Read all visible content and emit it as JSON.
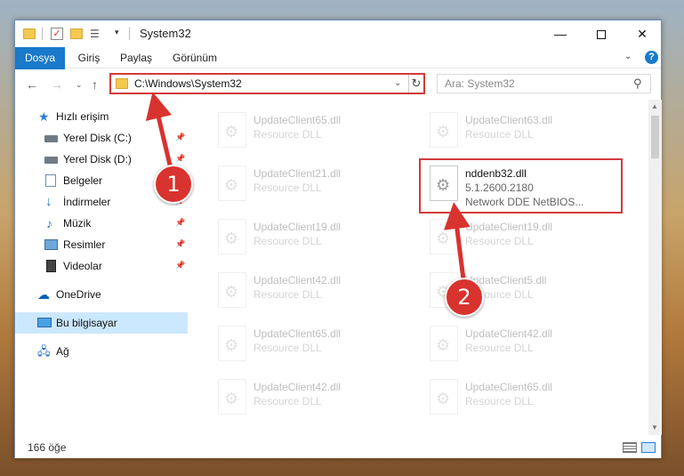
{
  "window": {
    "title": "System32"
  },
  "ribbon": {
    "tabs": [
      "Dosya",
      "Giriş",
      "Paylaş",
      "Görünüm"
    ],
    "help": "?"
  },
  "nav": {
    "address": "C:\\Windows\\System32",
    "search_placeholder": "Ara: System32"
  },
  "sidebar": {
    "items": [
      {
        "label": "Hızlı erişim",
        "icon": "star-icon",
        "pinned": false
      },
      {
        "label": "Yerel Disk (C:)",
        "icon": "drive-icon",
        "pinned": true
      },
      {
        "label": "Yerel Disk (D:)",
        "icon": "drive-icon",
        "pinned": true
      },
      {
        "label": "Belgeler",
        "icon": "document-icon",
        "pinned": true
      },
      {
        "label": "İndirmeler",
        "icon": "download-icon",
        "pinned": true
      },
      {
        "label": "Müzik",
        "icon": "music-icon",
        "pinned": true
      },
      {
        "label": "Resimler",
        "icon": "pictures-icon",
        "pinned": true
      },
      {
        "label": "Videolar",
        "icon": "video-icon",
        "pinned": true
      },
      {
        "label": "OneDrive",
        "icon": "cloud-icon",
        "pinned": false
      },
      {
        "label": "Bu bilgisayar",
        "icon": "computer-icon",
        "pinned": false,
        "selected": true
      },
      {
        "label": "Ağ",
        "icon": "network-icon",
        "pinned": false
      }
    ]
  },
  "files": {
    "left_column": [
      {
        "name": "UpdateClient65.dll",
        "desc": "Resource DLL"
      },
      {
        "name": "UpdateClient21.dll",
        "desc": "Resource DLL"
      },
      {
        "name": "UpdateClient19.dll",
        "desc": "Resource DLL"
      },
      {
        "name": "UpdateClient42.dll",
        "desc": "Resource DLL"
      },
      {
        "name": "UpdateClient65.dll",
        "desc": "Resource DLL"
      },
      {
        "name": "UpdateClient42.dll",
        "desc": "Resource DLL"
      }
    ],
    "right_column": [
      {
        "name": "UpdateClient63.dll",
        "desc": "Resource DLL"
      },
      {
        "name": "nddenb32.dll",
        "desc": "5.1.2600.2180",
        "desc2": "Network DDE NetBIOS...",
        "highlighted": true
      },
      {
        "name": "UpdateClient19.dll",
        "desc": "Resource DLL"
      },
      {
        "name": "UpdateClient5.dll",
        "desc": "Resource DLL"
      },
      {
        "name": "UpdateClient42.dll",
        "desc": "Resource DLL"
      },
      {
        "name": "UpdateClient65.dll",
        "desc": "Resource DLL"
      }
    ]
  },
  "status": {
    "count": "166 öğe"
  },
  "annotations": {
    "badge1": "1",
    "badge2": "2",
    "accent_color": "#d8332f"
  }
}
